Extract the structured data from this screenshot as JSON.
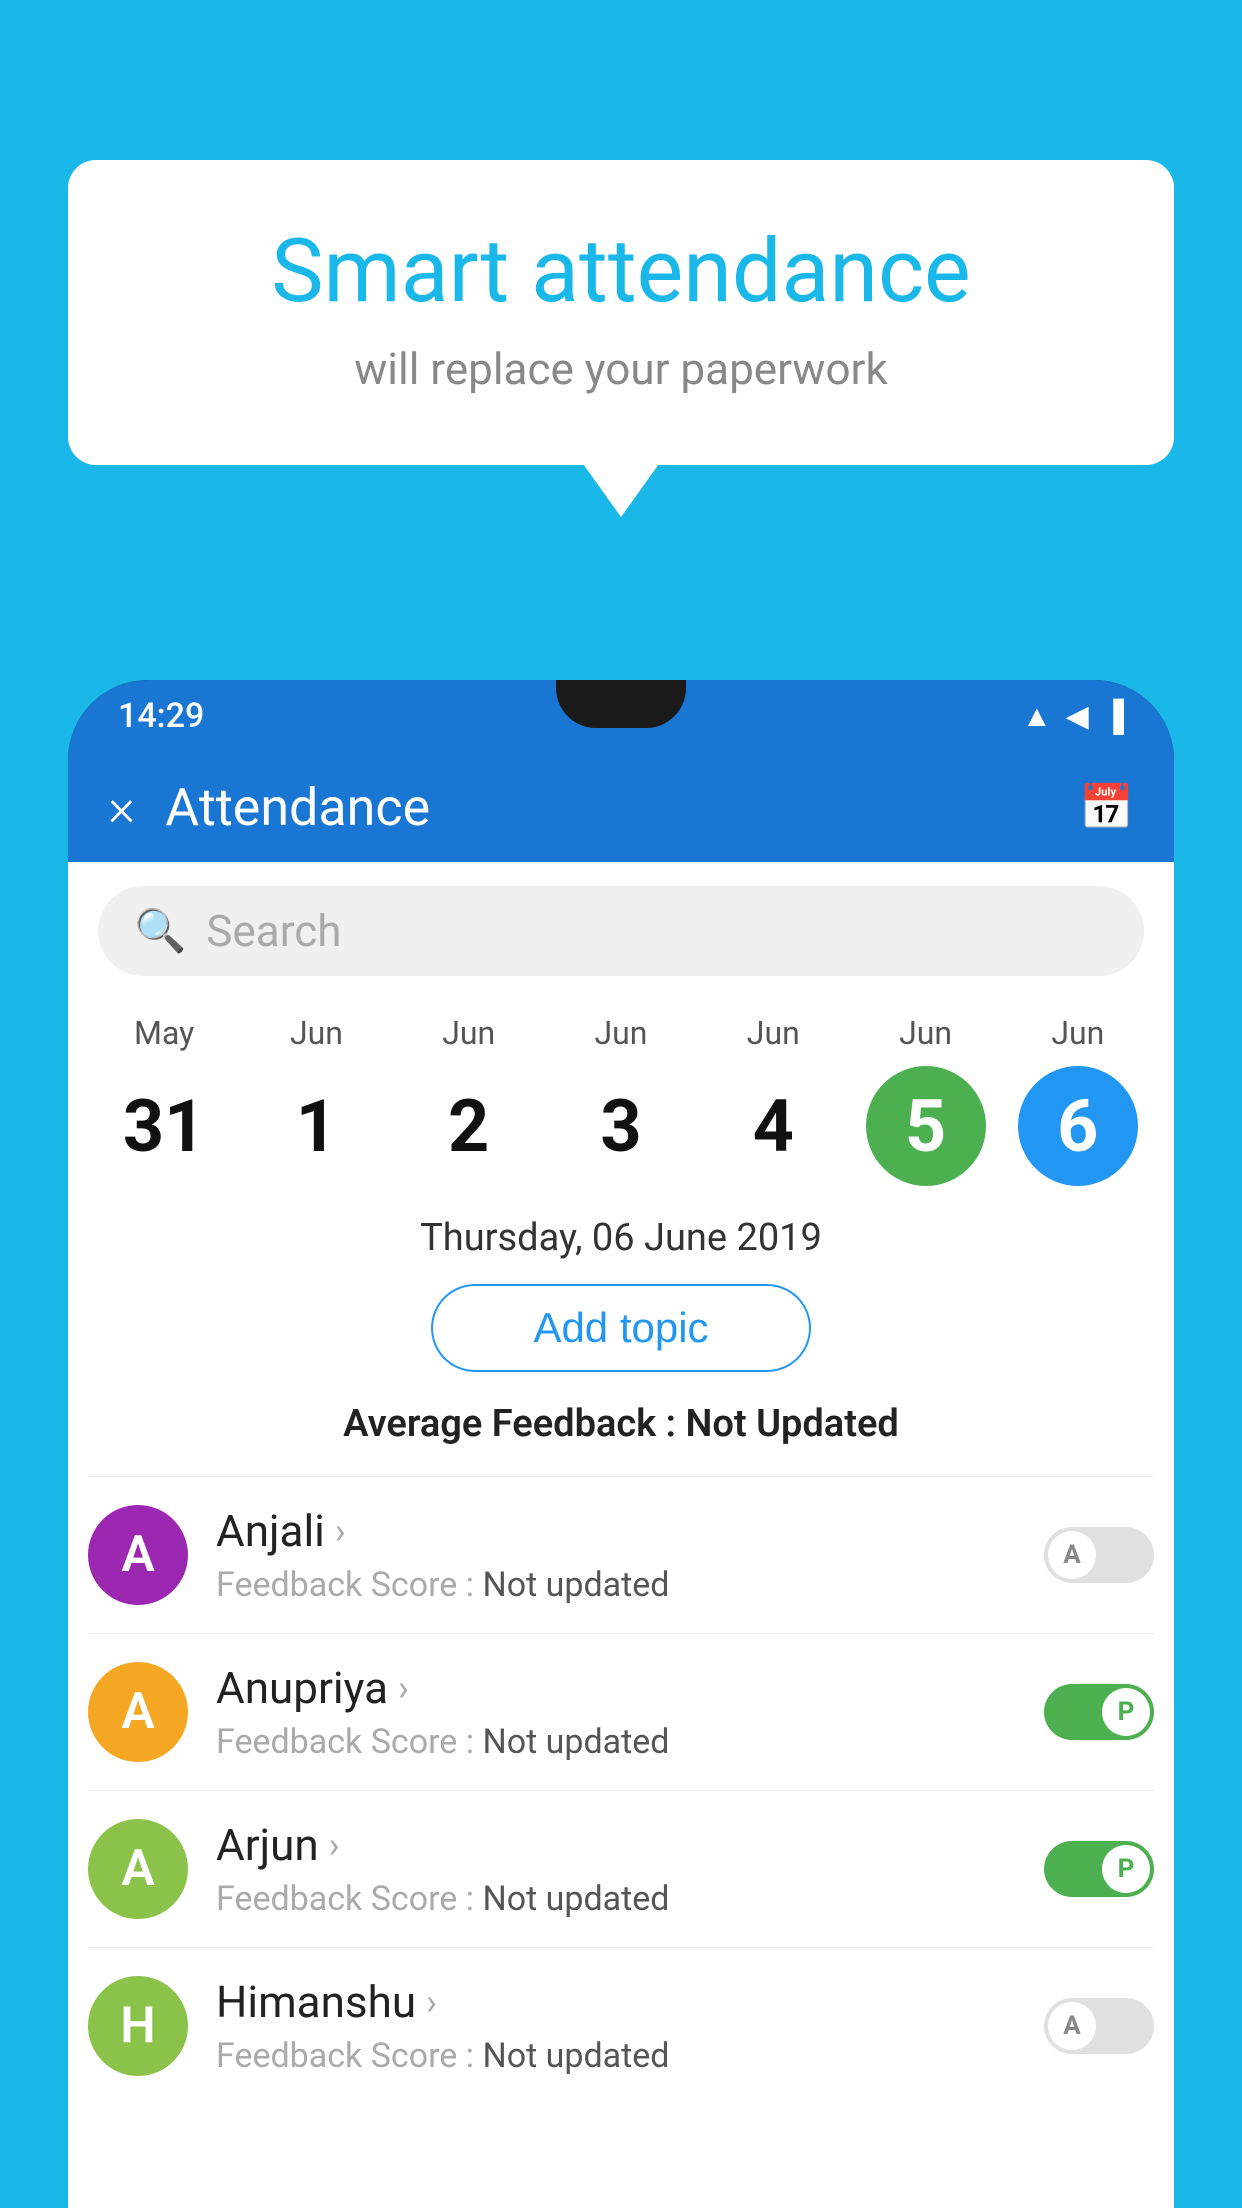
{
  "background_color": "#1ab8e8",
  "bubble": {
    "title": "Smart attendance",
    "subtitle": "will replace your paperwork"
  },
  "status_bar": {
    "time": "14:29",
    "icons": [
      "wifi",
      "signal",
      "battery"
    ]
  },
  "app_bar": {
    "title": "Attendance",
    "close_label": "×",
    "calendar_icon": "📅"
  },
  "search": {
    "placeholder": "Search"
  },
  "calendar": {
    "days": [
      {
        "month": "May",
        "date": "31",
        "style": "normal"
      },
      {
        "month": "Jun",
        "date": "1",
        "style": "normal"
      },
      {
        "month": "Jun",
        "date": "2",
        "style": "normal"
      },
      {
        "month": "Jun",
        "date": "3",
        "style": "normal"
      },
      {
        "month": "Jun",
        "date": "4",
        "style": "normal"
      },
      {
        "month": "Jun",
        "date": "5",
        "style": "green"
      },
      {
        "month": "Jun",
        "date": "6",
        "style": "blue"
      }
    ]
  },
  "selected_date": "Thursday, 06 June 2019",
  "add_topic_label": "Add topic",
  "avg_feedback_label": "Average Feedback :",
  "avg_feedback_value": "Not Updated",
  "students": [
    {
      "name": "Anjali",
      "initial": "A",
      "avatar_color": "#9c27b0",
      "feedback_label": "Feedback Score :",
      "feedback_value": "Not updated",
      "toggle": "off",
      "toggle_label": "A"
    },
    {
      "name": "Anupriya",
      "initial": "A",
      "avatar_color": "#f5a623",
      "feedback_label": "Feedback Score :",
      "feedback_value": "Not updated",
      "toggle": "on",
      "toggle_label": "P"
    },
    {
      "name": "Arjun",
      "initial": "A",
      "avatar_color": "#8bc34a",
      "feedback_label": "Feedback Score :",
      "feedback_value": "Not updated",
      "toggle": "on",
      "toggle_label": "P"
    },
    {
      "name": "Himanshu",
      "initial": "H",
      "avatar_color": "#8bc34a",
      "feedback_label": "Feedback Score :",
      "feedback_value": "Not updated",
      "toggle": "off",
      "toggle_label": "A"
    }
  ]
}
